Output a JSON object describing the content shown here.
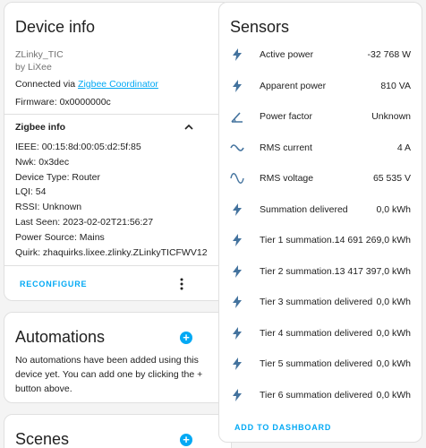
{
  "device": {
    "title": "Device info",
    "model": "ZLinky_TIC",
    "manufacturer": "by LiXee",
    "connected_prefix": "Connected via ",
    "connected_link": "Zigbee Coordinator",
    "firmware": "Firmware: 0x0000000c",
    "zigbee_info_title": "Zigbee info",
    "zigbee_lines": [
      "IEEE: 00:15:8d:00:05:d2:5f:85",
      "Nwk: 0x3dec",
      "Device Type: Router",
      "LQI: 54",
      "RSSI: Unknown",
      "Last Seen: 2023-02-02T21:56:27",
      "Power Source: Mains",
      "Quirk: zhaquirks.lixee.zlinky.ZLinkyTICFWV12"
    ],
    "reconfigure_label": "RECONFIGURE"
  },
  "automations": {
    "title": "Automations",
    "text": [
      "No automations have been added using this",
      "device yet. You can add one by clicking the +",
      "button above."
    ]
  },
  "scenes": {
    "title": "Scenes"
  },
  "sensors": {
    "title": "Sensors",
    "items": [
      {
        "name": "Active power",
        "value": "-32 768 W",
        "icon": "flash-icon"
      },
      {
        "name": "Apparent power",
        "value": "810 VA",
        "icon": "flash-icon"
      },
      {
        "name": "Power factor",
        "value": "Unknown",
        "icon": "angle-icon"
      },
      {
        "name": "RMS current",
        "value": "4 A",
        "icon": "current-ac-icon"
      },
      {
        "name": "RMS voltage",
        "value": "65 535 V",
        "icon": "sine-wave-icon"
      },
      {
        "name": "Summation delivered",
        "value": "0,0 kWh",
        "icon": "flash-icon"
      },
      {
        "name": "Tier 1 summation...",
        "value": "14 691 269,0 kWh",
        "icon": "flash-icon"
      },
      {
        "name": "Tier 2 summation...",
        "value": "13 417 397,0 kWh",
        "icon": "flash-icon"
      },
      {
        "name": "Tier 3 summation delivered",
        "value": "0,0 kWh",
        "icon": "flash-icon"
      },
      {
        "name": "Tier 4 summation delivered",
        "value": "0,0 kWh",
        "icon": "flash-icon"
      },
      {
        "name": "Tier 5 summation delivered",
        "value": "0,0 kWh",
        "icon": "flash-icon"
      },
      {
        "name": "Tier 6 summation delivered",
        "value": "0,0 kWh",
        "icon": "flash-icon"
      }
    ],
    "add_to_dashboard_label": "ADD TO DASHBOARD"
  },
  "colors": {
    "accent": "#03a9f4",
    "icon": "#44739e",
    "text": "#212121",
    "muted": "#727272"
  }
}
